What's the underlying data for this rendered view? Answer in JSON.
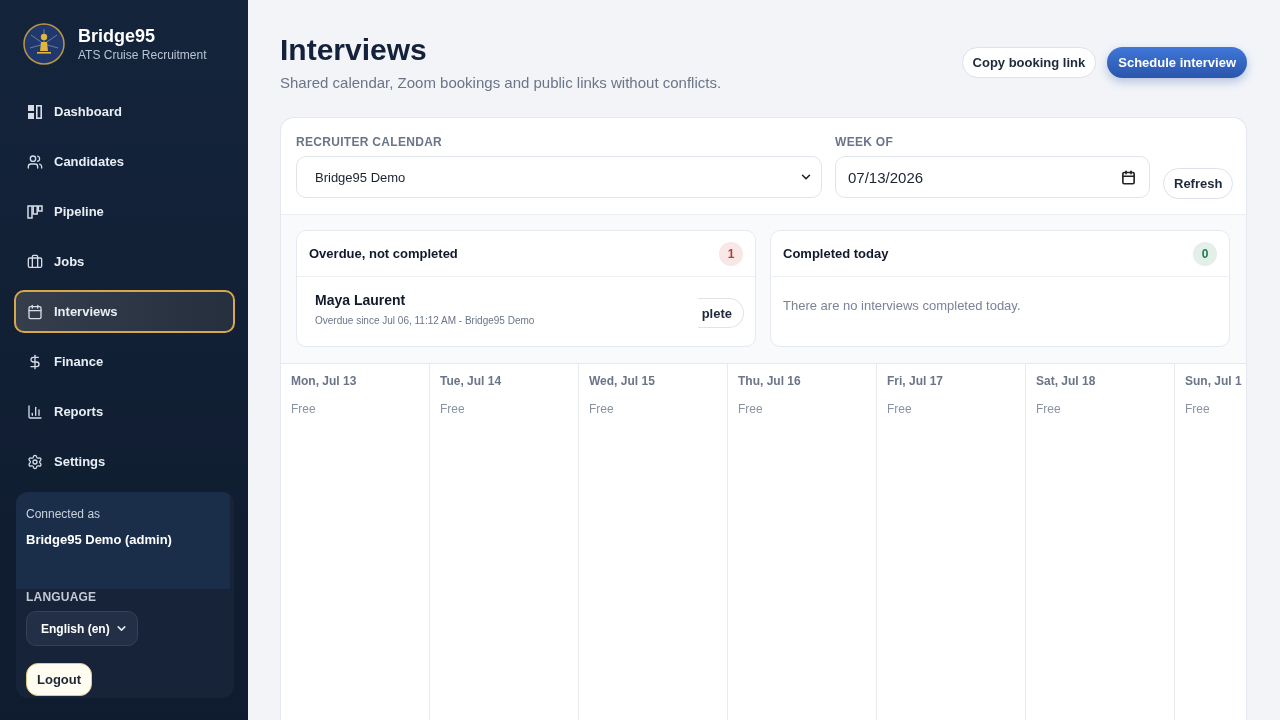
{
  "sidebar": {
    "brand": {
      "name": "Bridge95",
      "tagline": "ATS Cruise Recruitment"
    },
    "nav": [
      {
        "label": "Dashboard",
        "selected": false
      },
      {
        "label": "Candidates",
        "selected": false
      },
      {
        "label": "Pipeline",
        "selected": false
      },
      {
        "label": "Jobs",
        "selected": false
      },
      {
        "label": "Interviews",
        "selected": true
      },
      {
        "label": "Finance",
        "selected": false
      },
      {
        "label": "Reports",
        "selected": false
      },
      {
        "label": "Settings",
        "selected": false
      }
    ],
    "account": {
      "caption": "Connected as",
      "user": "Bridge95 Demo (admin)"
    },
    "language": {
      "label": "LANGUAGE",
      "value": "English (en)"
    },
    "logout": "Logout"
  },
  "header": {
    "title": "Interviews",
    "subtitle": "Shared calendar, Zoom bookings and public links without conflicts.",
    "buttons": [
      {
        "label": "Copy booking link",
        "kind": "secondary"
      },
      {
        "label": "Schedule interview",
        "kind": "primary"
      }
    ]
  },
  "filters": {
    "calendar": {
      "label": "RECRUITER CALENDAR",
      "value": "Bridge95 Demo"
    },
    "week": {
      "label": "WEEK OF",
      "value": "07/13/2026"
    },
    "refresh": "Refresh"
  },
  "panels": [
    {
      "title": "Overdue, not completed",
      "count": "1",
      "color": "#c0392b",
      "items": [
        {
          "name": "Maya Laurent",
          "detail": "Overdue since Jul 06, 11:12 AM - Bridge95 Demo",
          "action": "plete"
        }
      ]
    },
    {
      "title": "Completed today",
      "count": "0",
      "color": "#1f7a4c",
      "empty_message": "There are no interviews completed today."
    }
  ],
  "calendar": {
    "days": [
      {
        "label": "Mon, Jul 13",
        "status": "Free"
      },
      {
        "label": "Tue, Jul 14",
        "status": "Free"
      },
      {
        "label": "Wed, Jul 15",
        "status": "Free"
      },
      {
        "label": "Thu, Jul 16",
        "status": "Free"
      },
      {
        "label": "Fri, Jul 17",
        "status": "Free"
      },
      {
        "label": "Sat, Jul 18",
        "status": "Free"
      },
      {
        "label": "Sun, Jul 1",
        "status": "Free"
      }
    ]
  }
}
